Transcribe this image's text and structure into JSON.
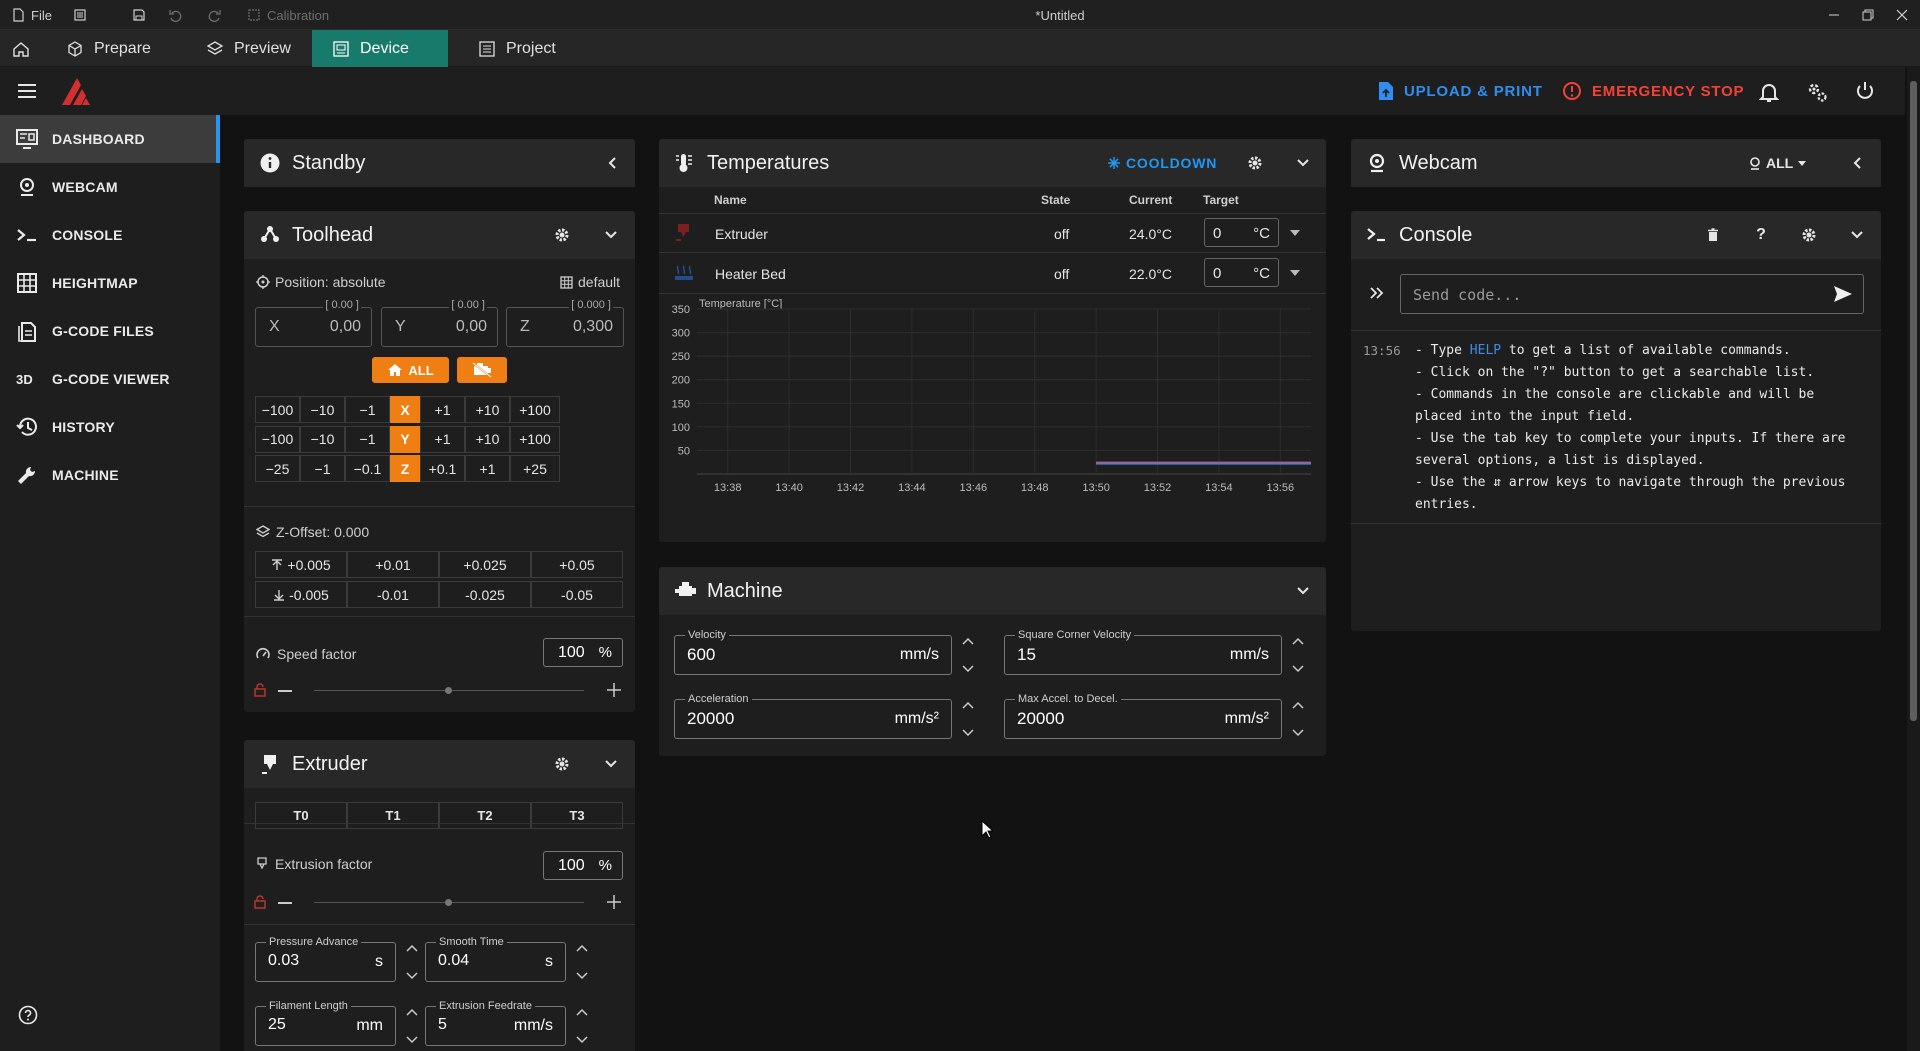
{
  "titlebar": {
    "file_label": "File",
    "calibration_label": "Calibration",
    "window_title": "*Untitled"
  },
  "tabs": [
    {
      "label": "Prepare"
    },
    {
      "label": "Preview"
    },
    {
      "label": "Device"
    },
    {
      "label": "Project"
    }
  ],
  "header": {
    "upload_label": "UPLOAD & PRINT",
    "estop_label": "EMERGENCY STOP"
  },
  "sidebar": {
    "items": [
      {
        "label": "DASHBOARD"
      },
      {
        "label": "WEBCAM"
      },
      {
        "label": "CONSOLE"
      },
      {
        "label": "HEIGHTMAP"
      },
      {
        "label": "G-CODE FILES"
      },
      {
        "label": "G-CODE VIEWER"
      },
      {
        "label": "HISTORY"
      },
      {
        "label": "MACHINE"
      }
    ]
  },
  "standby": {
    "title": "Standby"
  },
  "toolhead": {
    "title": "Toolhead",
    "position_label": "Position: absolute",
    "default_label": "default",
    "axes": [
      {
        "name": "X",
        "bracket": "[ 0.00 ]",
        "value": "0,00"
      },
      {
        "name": "Y",
        "bracket": "[ 0.00 ]",
        "value": "0,00"
      },
      {
        "name": "Z",
        "bracket": "[ 0.000 ]",
        "value": "0,300"
      }
    ],
    "home_all_label": "ALL",
    "jog_rows": [
      [
        "−100",
        "−10",
        "−1",
        "X",
        "+1",
        "+10",
        "+100"
      ],
      [
        "−100",
        "−10",
        "−1",
        "Y",
        "+1",
        "+10",
        "+100"
      ],
      [
        "−25",
        "−1",
        "−0.1",
        "Z",
        "+0.1",
        "+1",
        "+25"
      ]
    ],
    "zoffset_label": "Z-Offset: 0.000",
    "zoffset_up": [
      "+0.005",
      "+0.01",
      "+0.025",
      "+0.05"
    ],
    "zoffset_down": [
      "-0.005",
      "-0.01",
      "-0.025",
      "-0.05"
    ],
    "speed_label": "Speed factor",
    "speed_value": "100",
    "speed_unit": "%"
  },
  "extruder": {
    "title": "Extruder",
    "tools": [
      "T0",
      "T1",
      "T2",
      "T3"
    ],
    "factor_label": "Extrusion factor",
    "factor_value": "100",
    "factor_unit": "%",
    "fields": [
      {
        "label": "Pressure Advance",
        "value": "0.03",
        "unit": "s"
      },
      {
        "label": "Smooth Time",
        "value": "0.04",
        "unit": "s"
      },
      {
        "label": "Filament Length",
        "value": "25",
        "unit": "mm"
      },
      {
        "label": "Extrusion Feedrate",
        "value": "5",
        "unit": "mm/s"
      }
    ]
  },
  "temperatures": {
    "title": "Temperatures",
    "cooldown_label": "COOLDOWN",
    "columns": [
      "Name",
      "State",
      "Current",
      "Target"
    ],
    "rows": [
      {
        "name": "Extruder",
        "state": "off",
        "current": "24.0°C",
        "target": "0",
        "unit": "°C"
      },
      {
        "name": "Heater Bed",
        "state": "off",
        "current": "22.0°C",
        "target": "0",
        "unit": "°C"
      }
    ]
  },
  "chart_data": {
    "type": "line",
    "ylabel": "Temperature [°C]",
    "ylim": [
      0,
      350
    ],
    "yticks": [
      "350",
      "300",
      "250",
      "200",
      "150",
      "100",
      "50"
    ],
    "xticks": [
      "13:38",
      "13:40",
      "13:42",
      "13:44",
      "13:46",
      "13:48",
      "13:50",
      "13:52",
      "13:54",
      "13:56"
    ],
    "grid": true,
    "series": [
      {
        "name": "Extruder",
        "color": "#e05555",
        "x": [
          "13:50",
          "13:57"
        ],
        "values": [
          24,
          24
        ]
      },
      {
        "name": "Heater Bed",
        "color": "#4a7dd6",
        "x": [
          "13:50",
          "13:57"
        ],
        "values": [
          22,
          22
        ]
      }
    ]
  },
  "machine": {
    "title": "Machine",
    "fields": [
      {
        "label": "Velocity",
        "value": "600",
        "unit": "mm/s"
      },
      {
        "label": "Square Corner Velocity",
        "value": "15",
        "unit": "mm/s"
      },
      {
        "label": "Acceleration",
        "value": "20000",
        "unit": "mm/s²"
      },
      {
        "label": "Max Accel. to Decel.",
        "value": "20000",
        "unit": "mm/s²"
      }
    ]
  },
  "webcam": {
    "title": "Webcam",
    "filter_label": "ALL"
  },
  "console": {
    "title": "Console",
    "placeholder": "Send code...",
    "timestamp": "13:56",
    "lines": [
      {
        "pre": "- Type ",
        "kw": "HELP",
        "post": " to get a list of available commands."
      },
      {
        "pre": "- Click on the \"?\" button to get a searchable list.",
        "kw": "",
        "post": ""
      },
      {
        "pre": "- Commands in the console are clickable and will be",
        "kw": "",
        "post": ""
      },
      {
        "pre": "placed into the input field.",
        "kw": "",
        "post": ""
      },
      {
        "pre": "- Use the tab key to complete your inputs. If there are",
        "kw": "",
        "post": ""
      },
      {
        "pre": "several options, a list is displayed.",
        "kw": "",
        "post": ""
      },
      {
        "pre": "- Use the ⇵ arrow keys to navigate through the previous",
        "kw": "",
        "post": ""
      },
      {
        "pre": "entries.",
        "kw": "",
        "post": ""
      }
    ]
  },
  "colors": {
    "accent_orange": "#ef7f13",
    "device_tab": "#187a6a",
    "link_blue": "#2196f3",
    "estop_red": "#f44336"
  }
}
